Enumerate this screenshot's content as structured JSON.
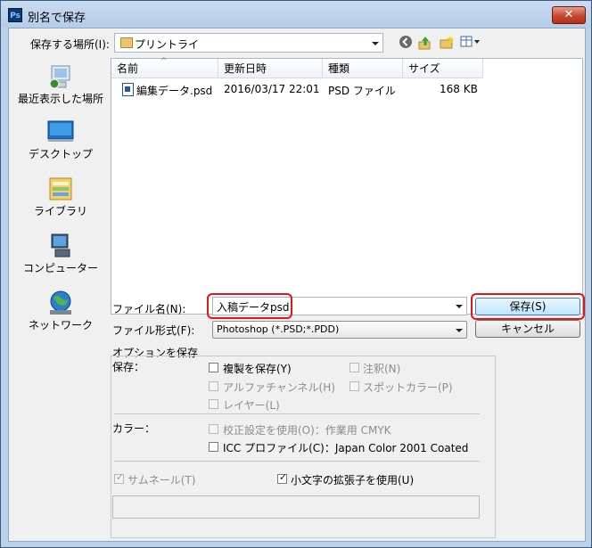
{
  "window": {
    "title": "別名で保存",
    "close_glyph": "✕",
    "app_icon": "Ps"
  },
  "location": {
    "label": "保存する場所(I):",
    "value": "プリントライ"
  },
  "toolbar": {
    "icons": [
      "back-icon",
      "up-folder-icon",
      "new-folder-icon",
      "view-menu-icon"
    ]
  },
  "places": [
    {
      "label": "最近表示した場所",
      "icon": "recent-places-icon"
    },
    {
      "label": "デスクトップ",
      "icon": "desktop-icon"
    },
    {
      "label": "ライブラリ",
      "icon": "libraries-icon"
    },
    {
      "label": "コンピューター",
      "icon": "computer-icon"
    },
    {
      "label": "ネットワーク",
      "icon": "network-icon"
    }
  ],
  "file_list": {
    "columns": [
      "名前",
      "更新日時",
      "種類",
      "サイズ"
    ],
    "rows": [
      {
        "name": "編集データ.psd",
        "modified": "2016/03/17 22:01",
        "type": "PSD ファイル",
        "size": "168 KB"
      }
    ]
  },
  "filename": {
    "label": "ファイル名(N):",
    "value": "入稿データpsd"
  },
  "format": {
    "label": "ファイル形式(F):",
    "value": "Photoshop (*.PSD;*.PDD)"
  },
  "buttons": {
    "save": "保存(S)",
    "cancel": "キャンセル"
  },
  "options": {
    "title": "オプションを保存",
    "save_label": "保存：",
    "as_copy": "複製を保存(Y)",
    "notes": "注釈(N)",
    "alpha": "アルファチャンネル(H)",
    "spot": "スポットカラー(P)",
    "layers": "レイヤー(L)",
    "color_label": "カラー：",
    "proof": "校正設定を使用(O)：作業用 CMYK",
    "icc": "ICC プロファイル(C)：Japan Color 2001 Coated",
    "thumbnail": "サムネール(T)",
    "lowercase": "小文字の拡張子を使用(U)"
  },
  "highlight_color": "#e3151a"
}
